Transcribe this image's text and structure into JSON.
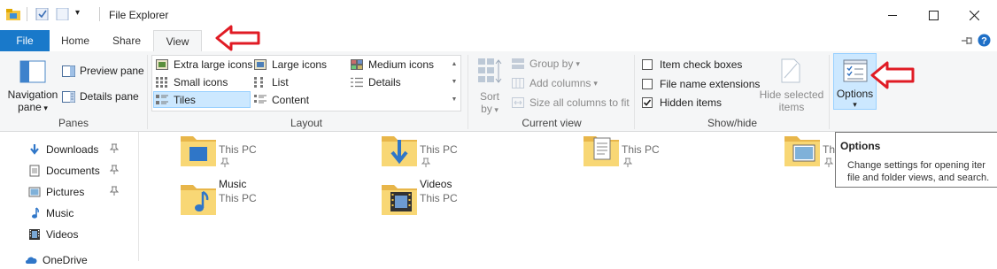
{
  "window": {
    "title": "File Explorer",
    "controls": {
      "minimize": "—",
      "maximize": "☐",
      "close": "✕"
    }
  },
  "tabs": {
    "file": "File",
    "home": "Home",
    "share": "Share",
    "view": "View"
  },
  "ribbon": {
    "panes": {
      "group_label": "Panes",
      "navigation_pane_l1": "Navigation",
      "navigation_pane_l2": "pane",
      "preview_pane": "Preview pane",
      "details_pane": "Details pane"
    },
    "layout": {
      "group_label": "Layout",
      "extra_large_icons": "Extra large icons",
      "large_icons": "Large icons",
      "medium_icons": "Medium icons",
      "small_icons": "Small icons",
      "list": "List",
      "details": "Details",
      "tiles": "Tiles",
      "content": "Content",
      "selected": "Tiles"
    },
    "current_view": {
      "group_label": "Current view",
      "sort_l1": "Sort",
      "sort_l2": "by",
      "group_by": "Group by",
      "add_columns": "Add columns",
      "size_all_columns": "Size all columns to fit"
    },
    "show_hide": {
      "group_label": "Show/hide",
      "item_check_boxes": "Item check boxes",
      "item_check_boxes_checked": false,
      "file_name_extensions": "File name extensions",
      "file_name_extensions_checked": false,
      "hidden_items": "Hidden items",
      "hidden_items_checked": true,
      "hide_selected_l1": "Hide selected",
      "hide_selected_l2": "items"
    },
    "options": {
      "label": "Options"
    }
  },
  "nav_pane": {
    "items": [
      {
        "label": "Downloads",
        "icon": "download-arrow-icon",
        "pinned": true
      },
      {
        "label": "Documents",
        "icon": "document-icon",
        "pinned": true
      },
      {
        "label": "Pictures",
        "icon": "pictures-icon",
        "pinned": true
      },
      {
        "label": "Music",
        "icon": "music-note-icon",
        "pinned": false
      },
      {
        "label": "Videos",
        "icon": "film-icon",
        "pinned": false
      },
      {
        "label": "OneDrive",
        "icon": "cloud-icon",
        "pinned": false
      }
    ]
  },
  "content": {
    "tiles": [
      {
        "name": "",
        "sub": "This PC",
        "icon": "desktop-folder-icon"
      },
      {
        "name": "",
        "sub": "This PC",
        "icon": "downloads-folder-icon"
      },
      {
        "name": "",
        "sub": "This PC",
        "icon": "documents-folder-icon"
      },
      {
        "name": "",
        "sub": "Th",
        "icon": "pictures-folder-icon"
      },
      {
        "name": "Music",
        "sub": "This PC",
        "icon": "music-folder-icon"
      },
      {
        "name": "Videos",
        "sub": "This PC",
        "icon": "videos-folder-icon"
      }
    ]
  },
  "tooltip": {
    "title": "Options",
    "line1": "Change settings for opening iter",
    "line2": "file and folder views, and search."
  },
  "colors": {
    "accent_file_tab": "#1979ca",
    "annotation_arrow": "#e01b24",
    "selected_layout_bg": "#cce8ff",
    "folder_yellow": "#f8d775"
  }
}
